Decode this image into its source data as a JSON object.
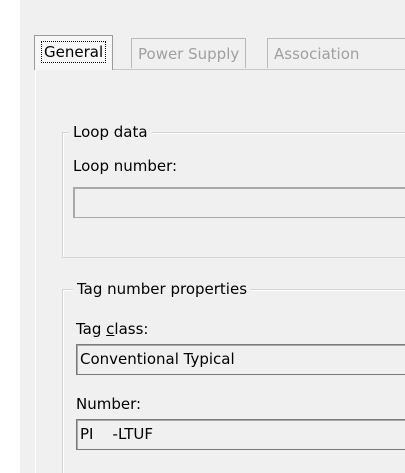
{
  "tabs": [
    {
      "label": "General",
      "active": true
    },
    {
      "label": "Power Supply",
      "active": false
    },
    {
      "label": "Association",
      "active": false
    }
  ],
  "loop_data": {
    "title": "Loop data",
    "loop_number_label": "Loop number:",
    "loop_number_value": ""
  },
  "tag_properties": {
    "title": "Tag number properties",
    "tag_class_label_pre": "Tag ",
    "tag_class_label_mnemonic": "c",
    "tag_class_label_post": "lass:",
    "tag_class_value": "Conventional Typical",
    "number_label": "Number:",
    "number_value": "PI    -LTUF"
  }
}
